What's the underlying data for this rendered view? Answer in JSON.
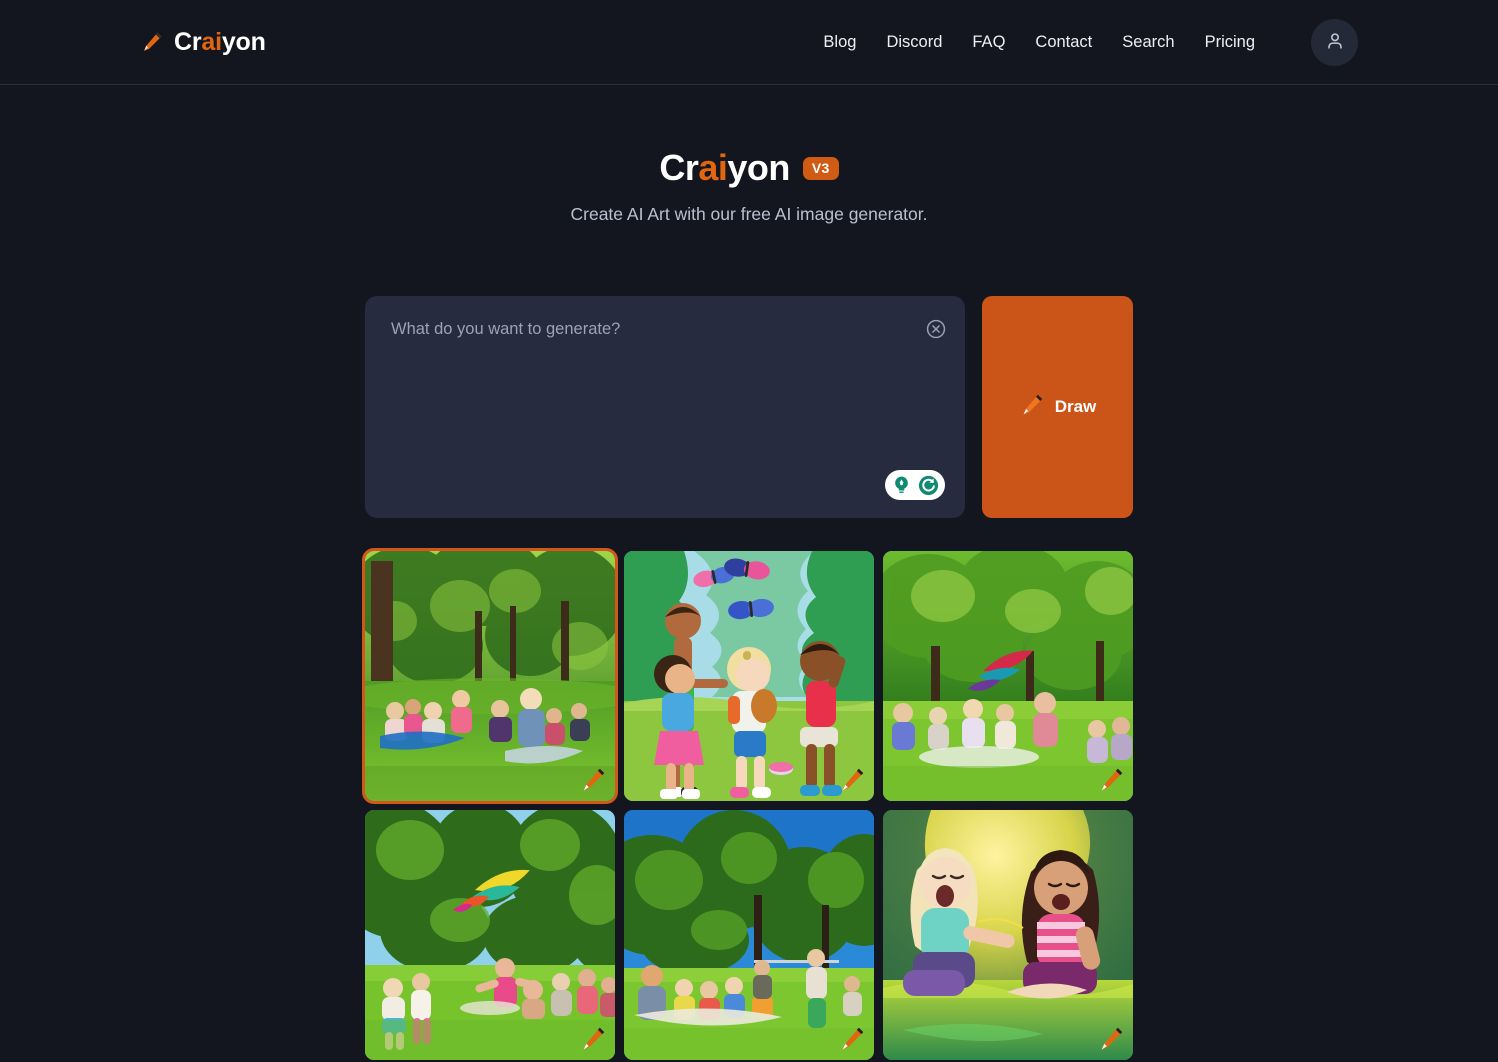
{
  "header": {
    "brand": {
      "name": "Craiyon",
      "part_white_1": "Cr",
      "part_orange": "ai",
      "part_white_2": "yon",
      "icon": "pencil-icon"
    },
    "nav": [
      {
        "label": "Blog"
      },
      {
        "label": "Discord"
      },
      {
        "label": "FAQ"
      },
      {
        "label": "Contact"
      },
      {
        "label": "Search"
      },
      {
        "label": "Pricing"
      }
    ],
    "account_icon": "user-icon"
  },
  "hero": {
    "title_part1": "Cr",
    "title_ai": "ai",
    "title_part2": "yon",
    "version_badge": "V3",
    "subtitle": "Create AI Art with our free AI image generator."
  },
  "prompt": {
    "placeholder": "What do you want to generate?",
    "value": "",
    "clear_icon": "close-circle-icon",
    "tools": [
      {
        "name": "idea-lightbulb-icon",
        "title": "Suggest a prompt"
      },
      {
        "name": "regenerate-icon",
        "title": "Regenerate"
      }
    ],
    "tool_color": "#0f8a72"
  },
  "draw_button": {
    "label": "Draw",
    "icon": "pencil-icon",
    "color": "#cb5518"
  },
  "results": {
    "selected_index": 0,
    "images": [
      {
        "alt": "People having a picnic on grass in a sunny green park",
        "watermark": "craiyon-crayon-watermark"
      },
      {
        "alt": "Cartoon illustration of four children playing in a park with butterflies",
        "watermark": "craiyon-crayon-watermark"
      },
      {
        "alt": "Families sitting on a lawn in a park with a colorful kite in the air",
        "watermark": "craiyon-crayon-watermark"
      },
      {
        "alt": "Children running on a park lawn while a rainbow kite flies overhead",
        "watermark": "craiyon-crayon-watermark"
      },
      {
        "alt": "Group picnicking on grass under tall trees with a clear blue sky",
        "watermark": "craiyon-crayon-watermark"
      },
      {
        "alt": "Stylized art of two smiling girls sitting on sunlit grass",
        "watermark": "craiyon-crayon-watermark"
      }
    ]
  },
  "colors": {
    "background": "#14161f",
    "surface": "#262b40",
    "accent_orange": "#cb5518",
    "brand_orange": "#e2650f",
    "teal": "#0f8a72",
    "text": "#eceff4",
    "muted_text": "#b9c0d0"
  }
}
